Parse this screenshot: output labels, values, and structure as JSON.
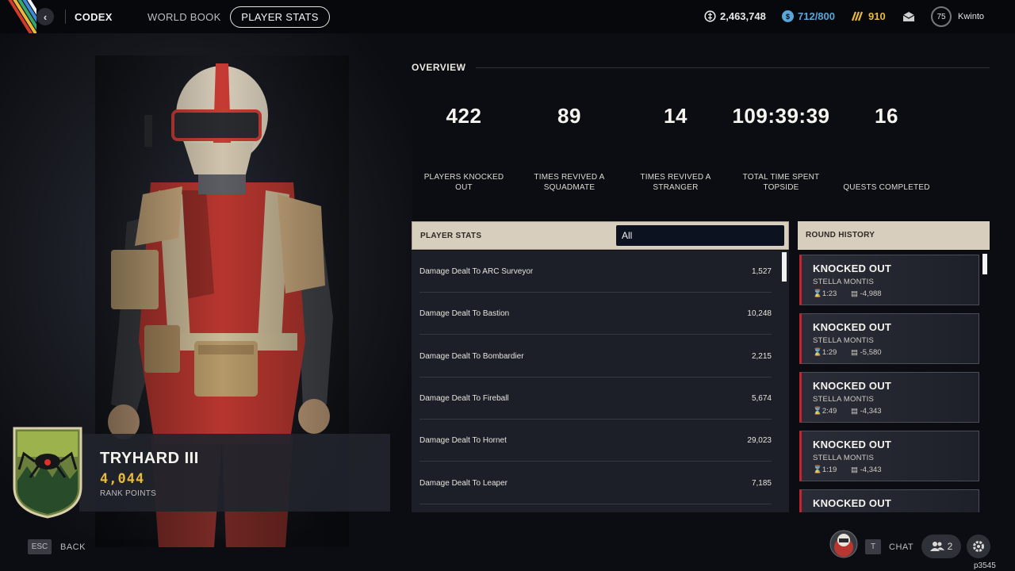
{
  "nav": {
    "back_icon": "chevron-left-icon",
    "codex": "CODEX",
    "world_book": "WORLD BOOK",
    "player_stats": "PLAYER STATS"
  },
  "currencies": [
    {
      "icon": "coins-icon",
      "value": "2,463,748",
      "color": "#e8e8e8"
    },
    {
      "icon": "cred-icon",
      "value": "712/800",
      "color": "#5aa6d8"
    },
    {
      "icon": "raider-token-icon",
      "value": "910",
      "color": "#e8b93a"
    }
  ],
  "profile": {
    "level": "75",
    "username": "Kwinto"
  },
  "rank": {
    "title": "TRYHARD III",
    "points": "4,044",
    "points_label": "RANK POINTS"
  },
  "overview": {
    "title": "OVERVIEW",
    "stats": [
      {
        "value": "422",
        "label": "PLAYERS KNOCKED OUT"
      },
      {
        "value": "89",
        "label": "TIMES REVIVED A SQUADMATE"
      },
      {
        "value": "14",
        "label": "TIMES REVIVED A STRANGER"
      },
      {
        "value": "109:39:39",
        "label": "TOTAL TIME SPENT TOPSIDE"
      },
      {
        "value": "16",
        "label": "QUESTS COMPLETED"
      }
    ]
  },
  "player_stats": {
    "title": "PLAYER STATS",
    "filter": "All",
    "rows": [
      {
        "name": "Damage Dealt To ARC Surveyor",
        "value": "1,527"
      },
      {
        "name": "Damage Dealt To Bastion",
        "value": "10,248"
      },
      {
        "name": "Damage Dealt To Bombardier",
        "value": "2,215"
      },
      {
        "name": "Damage Dealt To Fireball",
        "value": "5,674"
      },
      {
        "name": "Damage Dealt To Hornet",
        "value": "29,023"
      },
      {
        "name": "Damage Dealt To Leaper",
        "value": "7,185"
      }
    ]
  },
  "round_history": {
    "title": "ROUND HISTORY",
    "rounds": [
      {
        "result": "KNOCKED OUT",
        "map": "STELLA MONTIS",
        "time": "1:23",
        "coins": "-4,988"
      },
      {
        "result": "KNOCKED OUT",
        "map": "STELLA MONTIS",
        "time": "1:29",
        "coins": "-5,580"
      },
      {
        "result": "KNOCKED OUT",
        "map": "STELLA MONTIS",
        "time": "2:49",
        "coins": "-4,343"
      },
      {
        "result": "KNOCKED OUT",
        "map": "STELLA MONTIS",
        "time": "1:19",
        "coins": "-4,343"
      },
      {
        "result": "KNOCKED OUT",
        "map": "",
        "time": "",
        "coins": ""
      }
    ]
  },
  "footer": {
    "back_key": "ESC",
    "back_label": "BACK",
    "chat_key": "T",
    "chat_label": "CHAT",
    "party_count": "2",
    "build_id": "p3545"
  },
  "colors": {
    "accent_red": "#c8222e",
    "panel_header": "#d8cebd",
    "gold": "#e8b93a"
  }
}
